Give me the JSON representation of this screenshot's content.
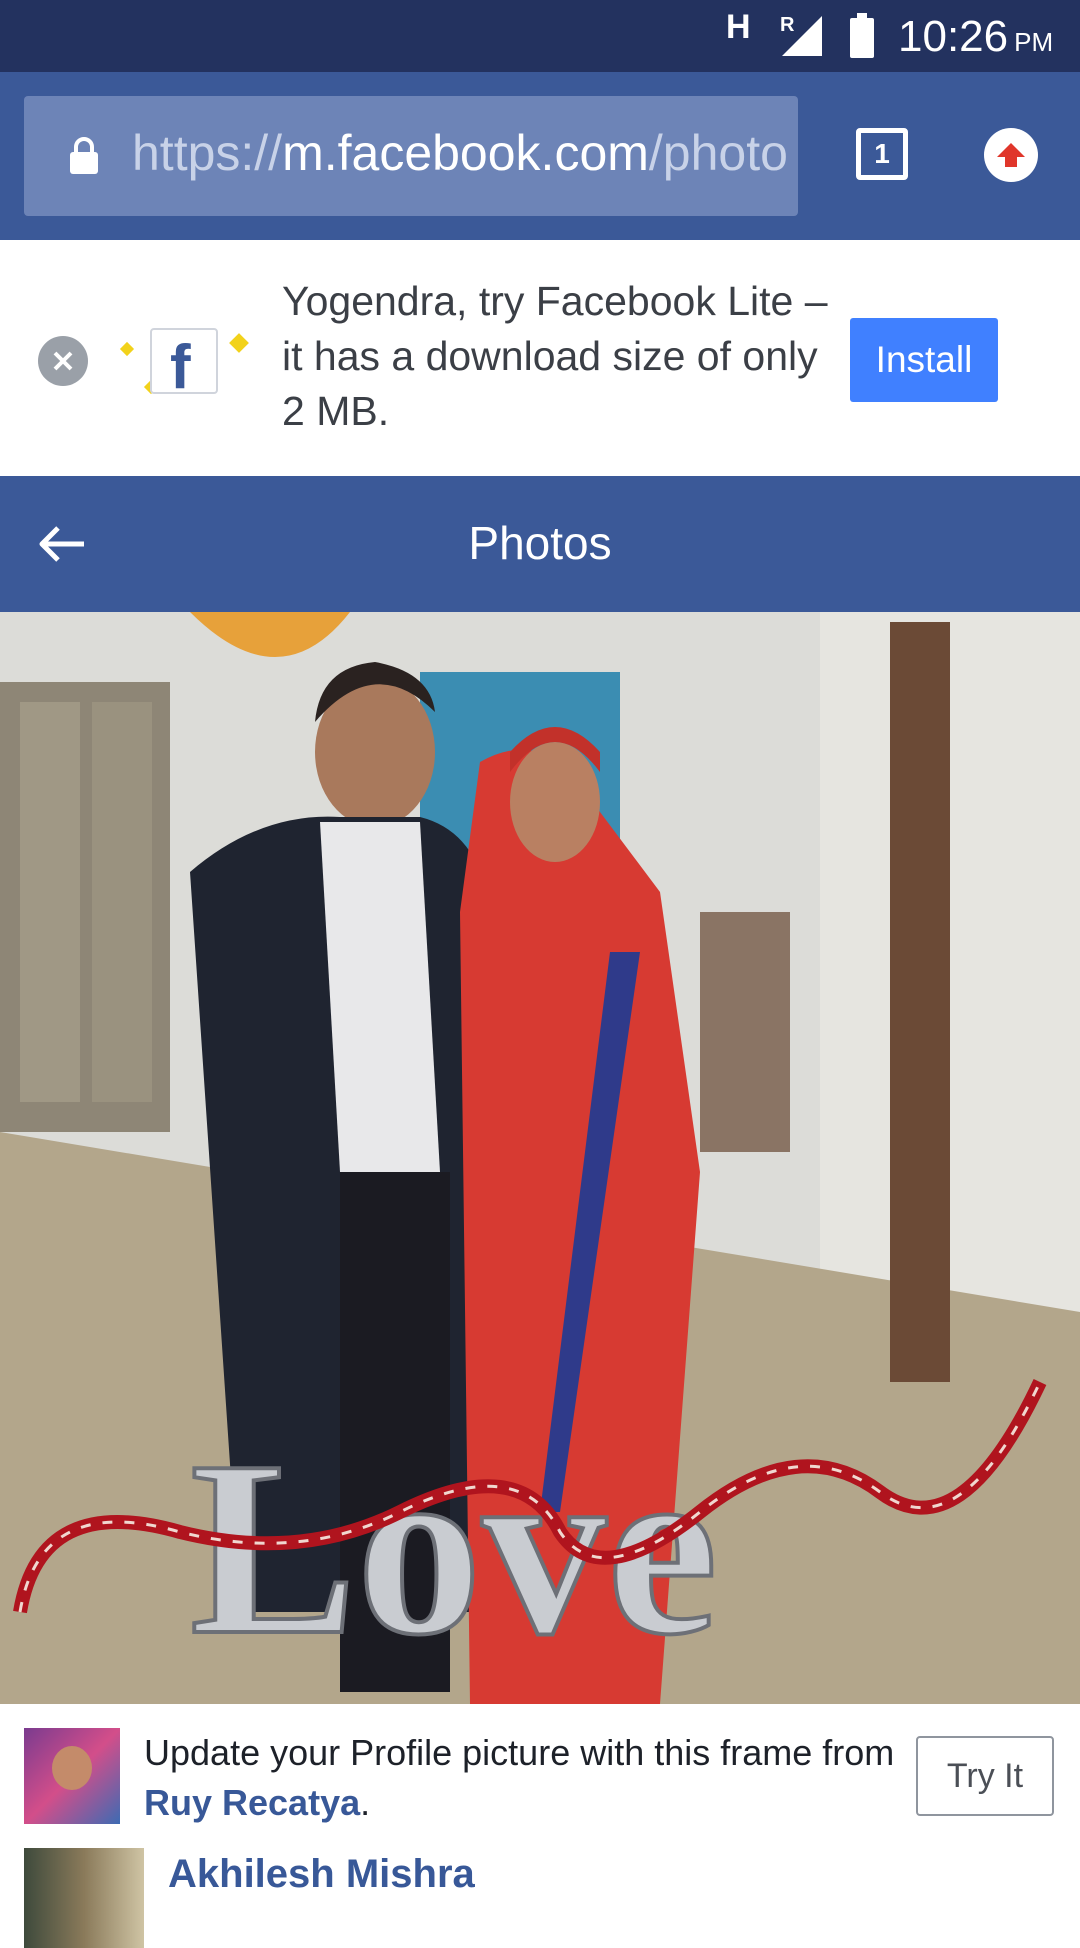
{
  "status_bar": {
    "network_letter": "H",
    "roaming": "R",
    "time": "10:26",
    "ampm": "PM"
  },
  "browser": {
    "url_scheme": "https://",
    "url_host": "m.facebook.com",
    "url_path": "/photo",
    "tab_count": "1"
  },
  "lite_banner": {
    "message": "Yogendra, try Facebook Lite – it has a download size of only 2 MB.",
    "install_label": "Install",
    "logo_letter": "f"
  },
  "photos_header": {
    "title": "Photos"
  },
  "frame_caption": {
    "text": "Update your Profile picture with this frame from ",
    "author": "Ruy Recatya",
    "suffix": ".",
    "try_label": "Try It"
  },
  "next_post": {
    "name": "Akhilesh Mishra"
  },
  "colors": {
    "status_bar": "#23325f",
    "facebook_blue": "#3b5998",
    "install_blue": "#4080ff",
    "link_blue": "#385898"
  }
}
